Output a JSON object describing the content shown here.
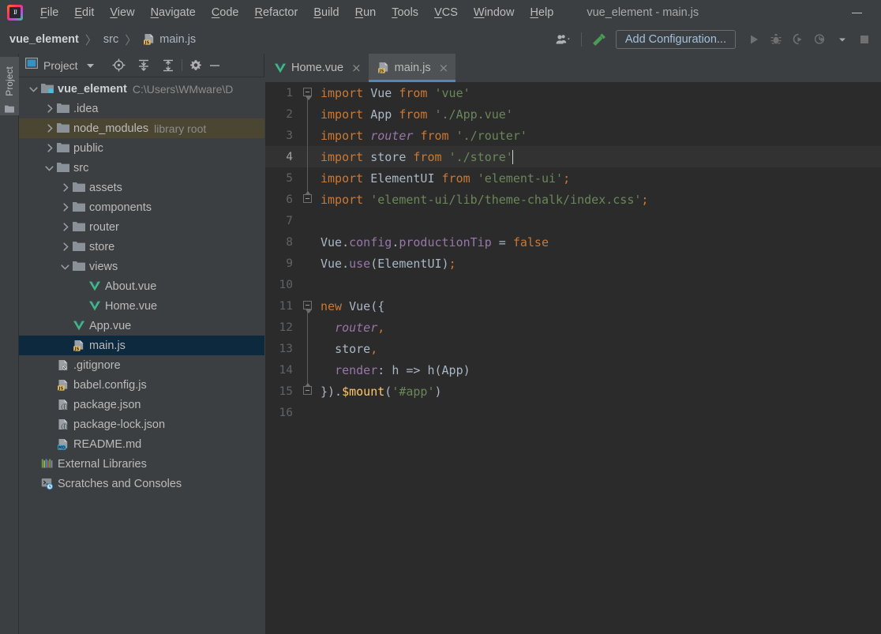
{
  "window": {
    "title": "vue_element - main.js",
    "minimize_label": "minimize",
    "app_icon": "intellij-idea-logo",
    "logo_letters": "IJ"
  },
  "menu": {
    "items": [
      {
        "label": "File",
        "mnemonic": "F"
      },
      {
        "label": "Edit",
        "mnemonic": "E"
      },
      {
        "label": "View",
        "mnemonic": "V"
      },
      {
        "label": "Navigate",
        "mnemonic": "N"
      },
      {
        "label": "Code",
        "mnemonic": "C"
      },
      {
        "label": "Refactor",
        "mnemonic": "R"
      },
      {
        "label": "Build",
        "mnemonic": "B"
      },
      {
        "label": "Run",
        "mnemonic": "R"
      },
      {
        "label": "Tools",
        "mnemonic": "T"
      },
      {
        "label": "VCS",
        "mnemonic": "V"
      },
      {
        "label": "Window",
        "mnemonic": "W"
      },
      {
        "label": "Help",
        "mnemonic": "H"
      }
    ]
  },
  "navbar": {
    "breadcrumb": [
      {
        "label": "vue_element",
        "style": "bold",
        "icon": ""
      },
      {
        "label": "src",
        "style": "plain",
        "icon": ""
      },
      {
        "label": "main.js",
        "style": "plain",
        "icon": "js-file-icon"
      }
    ],
    "separator": "〉",
    "add_configuration_label": "Add Configuration...",
    "buttons": [
      {
        "name": "user-settings-icon",
        "title": "User"
      },
      {
        "name": "build-hammer-icon",
        "title": "Build"
      },
      {
        "name": "run-icon",
        "title": "Run"
      },
      {
        "name": "debug-icon",
        "title": "Debug"
      },
      {
        "name": "run-with-coverage-icon",
        "title": "Run with Coverage"
      },
      {
        "name": "profile-icon",
        "title": "Profile"
      },
      {
        "name": "dropdown-arrow-icon",
        "title": "More"
      },
      {
        "name": "stop-icon",
        "title": "Stop"
      }
    ]
  },
  "tool_stripe": {
    "project_label": "Project",
    "project_icon": "folder-icon"
  },
  "project_panel": {
    "title": "Project",
    "header_icons": [
      {
        "name": "locate-icon",
        "title": "Select Opened File"
      },
      {
        "name": "expand-all-icon",
        "title": "Expand All"
      },
      {
        "name": "collapse-all-icon",
        "title": "Collapse All"
      },
      {
        "name": "gear-icon",
        "title": "Settings"
      },
      {
        "name": "hide-icon",
        "title": "Hide"
      }
    ],
    "tree": [
      {
        "label": "vue_element",
        "sub": "C:\\Users\\WMware\\D",
        "depth": 0,
        "arrow": "down",
        "icon": "project-folder-icon",
        "bold": true,
        "state": "normal"
      },
      {
        "label": ".idea",
        "sub": "",
        "depth": 1,
        "arrow": "right",
        "icon": "folder-icon",
        "bold": false,
        "state": "normal"
      },
      {
        "label": "node_modules",
        "sub": "library root",
        "depth": 1,
        "arrow": "right",
        "icon": "folder-icon",
        "bold": false,
        "state": "library"
      },
      {
        "label": "public",
        "sub": "",
        "depth": 1,
        "arrow": "right",
        "icon": "folder-icon",
        "bold": false,
        "state": "normal"
      },
      {
        "label": "src",
        "sub": "",
        "depth": 1,
        "arrow": "down",
        "icon": "folder-icon",
        "bold": false,
        "state": "normal"
      },
      {
        "label": "assets",
        "sub": "",
        "depth": 2,
        "arrow": "right",
        "icon": "folder-icon",
        "bold": false,
        "state": "normal"
      },
      {
        "label": "components",
        "sub": "",
        "depth": 2,
        "arrow": "right",
        "icon": "folder-icon",
        "bold": false,
        "state": "normal"
      },
      {
        "label": "router",
        "sub": "",
        "depth": 2,
        "arrow": "right",
        "icon": "folder-icon",
        "bold": false,
        "state": "normal"
      },
      {
        "label": "store",
        "sub": "",
        "depth": 2,
        "arrow": "right",
        "icon": "folder-icon",
        "bold": false,
        "state": "normal"
      },
      {
        "label": "views",
        "sub": "",
        "depth": 2,
        "arrow": "down",
        "icon": "folder-icon",
        "bold": false,
        "state": "normal"
      },
      {
        "label": "About.vue",
        "sub": "",
        "depth": 3,
        "arrow": "none",
        "icon": "vue-file-icon",
        "bold": false,
        "state": "normal"
      },
      {
        "label": "Home.vue",
        "sub": "",
        "depth": 3,
        "arrow": "none",
        "icon": "vue-file-icon",
        "bold": false,
        "state": "normal"
      },
      {
        "label": "App.vue",
        "sub": "",
        "depth": 2,
        "arrow": "none",
        "icon": "vue-file-icon",
        "bold": false,
        "state": "normal"
      },
      {
        "label": "main.js",
        "sub": "",
        "depth": 2,
        "arrow": "none",
        "icon": "js-file-icon",
        "bold": false,
        "state": "selected"
      },
      {
        "label": ".gitignore",
        "sub": "",
        "depth": 1,
        "arrow": "none",
        "icon": "gitignore-file-icon",
        "bold": false,
        "state": "normal"
      },
      {
        "label": "babel.config.js",
        "sub": "",
        "depth": 1,
        "arrow": "none",
        "icon": "js-file-icon",
        "bold": false,
        "state": "normal"
      },
      {
        "label": "package.json",
        "sub": "",
        "depth": 1,
        "arrow": "none",
        "icon": "json-file-icon",
        "bold": false,
        "state": "normal"
      },
      {
        "label": "package-lock.json",
        "sub": "",
        "depth": 1,
        "arrow": "none",
        "icon": "json-file-icon",
        "bold": false,
        "state": "normal"
      },
      {
        "label": "README.md",
        "sub": "",
        "depth": 1,
        "arrow": "none",
        "icon": "md-file-icon",
        "bold": false,
        "state": "normal"
      },
      {
        "label": "External Libraries",
        "sub": "",
        "depth": 0,
        "arrow": "none",
        "icon": "external-libraries-icon",
        "bold": false,
        "state": "normal"
      },
      {
        "label": "Scratches and Consoles",
        "sub": "",
        "depth": 0,
        "arrow": "none",
        "icon": "scratches-icon",
        "bold": false,
        "state": "normal"
      }
    ]
  },
  "editor": {
    "tabs": [
      {
        "label": "Home.vue",
        "icon": "vue-file-icon",
        "active": false,
        "close": "×"
      },
      {
        "label": "main.js",
        "icon": "js-file-icon",
        "active": true,
        "close": "×"
      }
    ],
    "current_line": 4,
    "total_lines": 16,
    "lines": [
      {
        "n": "1",
        "fold": "start",
        "tokens": [
          {
            "t": "import",
            "c": "kw"
          },
          {
            "t": " ",
            "c": "op"
          },
          {
            "t": "Vue",
            "c": "ident"
          },
          {
            "t": " ",
            "c": "op"
          },
          {
            "t": "from",
            "c": "kw"
          },
          {
            "t": " ",
            "c": "op"
          },
          {
            "t": "'vue'",
            "c": "str"
          }
        ]
      },
      {
        "n": "2",
        "fold": "mid",
        "tokens": [
          {
            "t": "import",
            "c": "kw"
          },
          {
            "t": " ",
            "c": "op"
          },
          {
            "t": "App",
            "c": "ident"
          },
          {
            "t": " ",
            "c": "op"
          },
          {
            "t": "from",
            "c": "kw"
          },
          {
            "t": " ",
            "c": "op"
          },
          {
            "t": "'./App.vue'",
            "c": "str"
          }
        ]
      },
      {
        "n": "3",
        "fold": "mid",
        "tokens": [
          {
            "t": "import",
            "c": "kw"
          },
          {
            "t": " ",
            "c": "op"
          },
          {
            "t": "router",
            "c": "prop italic"
          },
          {
            "t": " ",
            "c": "op"
          },
          {
            "t": "from",
            "c": "kw"
          },
          {
            "t": " ",
            "c": "op"
          },
          {
            "t": "'./router'",
            "c": "str"
          }
        ]
      },
      {
        "n": "4",
        "fold": "mid",
        "caret": true,
        "tokens": [
          {
            "t": "import",
            "c": "kw"
          },
          {
            "t": " ",
            "c": "op"
          },
          {
            "t": "store",
            "c": "ident"
          },
          {
            "t": " ",
            "c": "op"
          },
          {
            "t": "from",
            "c": "kw"
          },
          {
            "t": " ",
            "c": "op"
          },
          {
            "t": "'./store'",
            "c": "str"
          }
        ]
      },
      {
        "n": "5",
        "fold": "mid",
        "tokens": [
          {
            "t": "import",
            "c": "kw"
          },
          {
            "t": " ",
            "c": "op"
          },
          {
            "t": "ElementUI",
            "c": "cls"
          },
          {
            "t": " ",
            "c": "op"
          },
          {
            "t": "from",
            "c": "kw"
          },
          {
            "t": " ",
            "c": "op"
          },
          {
            "t": "'element-ui'",
            "c": "str"
          },
          {
            "t": ";",
            "c": "kw"
          }
        ]
      },
      {
        "n": "6",
        "fold": "end",
        "tokens": [
          {
            "t": "import",
            "c": "kw"
          },
          {
            "t": " ",
            "c": "op"
          },
          {
            "t": "'element-ui/lib/theme-chalk/index.css'",
            "c": "str"
          },
          {
            "t": ";",
            "c": "kw"
          }
        ]
      },
      {
        "n": "7",
        "fold": "none",
        "tokens": []
      },
      {
        "n": "8",
        "fold": "none",
        "tokens": [
          {
            "t": "Vue",
            "c": "ident"
          },
          {
            "t": ".",
            "c": "op"
          },
          {
            "t": "config",
            "c": "prop"
          },
          {
            "t": ".",
            "c": "op"
          },
          {
            "t": "productionTip",
            "c": "prop"
          },
          {
            "t": " = ",
            "c": "op"
          },
          {
            "t": "false",
            "c": "kw"
          }
        ]
      },
      {
        "n": "9",
        "fold": "none",
        "tokens": [
          {
            "t": "Vue",
            "c": "ident"
          },
          {
            "t": ".",
            "c": "op"
          },
          {
            "t": "use",
            "c": "prop"
          },
          {
            "t": "(",
            "c": "op"
          },
          {
            "t": "ElementUI",
            "c": "cls"
          },
          {
            "t": ")",
            "c": "op"
          },
          {
            "t": ";",
            "c": "kw"
          }
        ]
      },
      {
        "n": "10",
        "fold": "none",
        "tokens": []
      },
      {
        "n": "11",
        "fold": "start",
        "tokens": [
          {
            "t": "new",
            "c": "kw"
          },
          {
            "t": " ",
            "c": "op"
          },
          {
            "t": "Vue",
            "c": "ident"
          },
          {
            "t": "({",
            "c": "op"
          }
        ]
      },
      {
        "n": "12",
        "fold": "mid",
        "tokens": [
          {
            "t": "  ",
            "c": "op"
          },
          {
            "t": "router",
            "c": "prop italic"
          },
          {
            "t": ",",
            "c": "kw"
          }
        ]
      },
      {
        "n": "13",
        "fold": "mid",
        "tokens": [
          {
            "t": "  ",
            "c": "op"
          },
          {
            "t": "store",
            "c": "ident"
          },
          {
            "t": ",",
            "c": "kw"
          }
        ]
      },
      {
        "n": "14",
        "fold": "mid",
        "tokens": [
          {
            "t": "  ",
            "c": "op"
          },
          {
            "t": "render",
            "c": "prop"
          },
          {
            "t": ": ",
            "c": "op"
          },
          {
            "t": "h",
            "c": "ident"
          },
          {
            "t": " => ",
            "c": "op"
          },
          {
            "t": "h",
            "c": "ident"
          },
          {
            "t": "(",
            "c": "op"
          },
          {
            "t": "App",
            "c": "ident"
          },
          {
            "t": ")",
            "c": "op"
          }
        ]
      },
      {
        "n": "15",
        "fold": "endbr",
        "tokens": [
          {
            "t": "}).",
            "c": "op"
          },
          {
            "t": "$mount",
            "c": "fn"
          },
          {
            "t": "(",
            "c": "op"
          },
          {
            "t": "'#app'",
            "c": "str"
          },
          {
            "t": ")",
            "c": "op"
          }
        ]
      },
      {
        "n": "16",
        "fold": "none",
        "tokens": []
      }
    ]
  },
  "colors": {
    "chrome": "#3C3F41",
    "editor_bg": "#2B2B2B",
    "current_line_bg": "#323232",
    "selection_bg": "#0D293E",
    "library_root_bg": "#4B4632",
    "accent_blue": "#4A88C7",
    "keyword_orange": "#CC7832",
    "string_green": "#6A8759",
    "property_purple": "#9876AA",
    "identifier": "#A9B7C6",
    "function_yellow": "#FFC66D",
    "vue_green": "#41B883",
    "js_badge": "#E8BF6A",
    "md_badge": "#4DA6D6"
  }
}
